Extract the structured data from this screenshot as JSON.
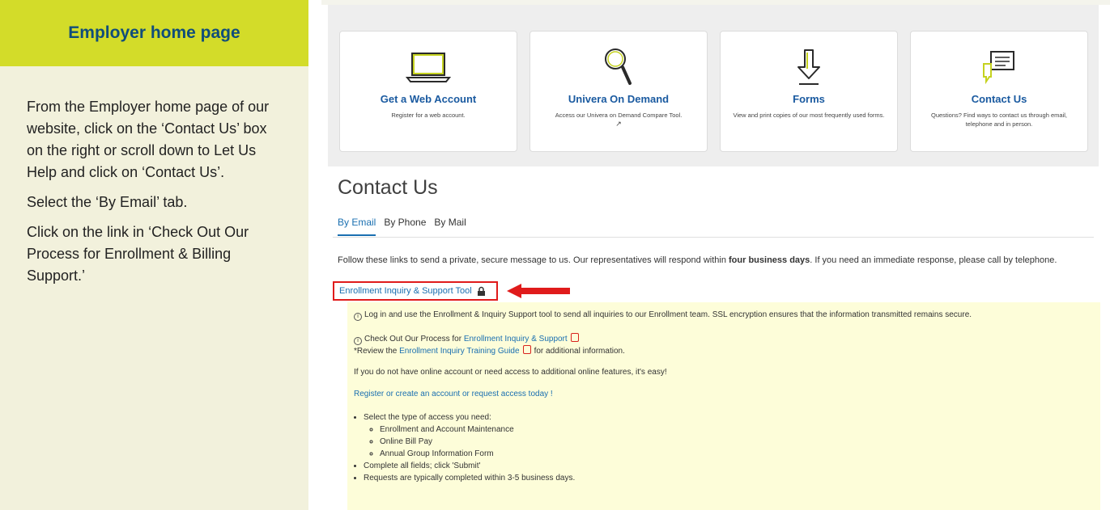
{
  "left": {
    "header": "Employer home page",
    "paragraphs": [
      "From the Employer home page of our website, click on the ‘Contact Us’ box on the right or scroll down to Let Us Help and click on ‘Contact Us’.",
      "Select the ‘By Email’ tab.",
      "Click on the link in ‘Check Out Our Process for Enrollment & Billing Support.’"
    ]
  },
  "cards": [
    {
      "title": "Get a Web Account",
      "desc": "Register for a web account.",
      "icon": "laptop-icon"
    },
    {
      "title": "Univera On Demand",
      "desc": "Access our Univera on Demand Compare Tool.",
      "icon": "magnifier-icon"
    },
    {
      "title": "Forms",
      "desc": "View and print copies of our most frequently used forms.",
      "icon": "download-arrow-icon"
    },
    {
      "title": "Contact Us",
      "desc": "Questions? Find ways to contact us through email, telephone and in person.",
      "icon": "chat-icon"
    }
  ],
  "contact": {
    "title": "Contact Us",
    "tabs": [
      "By Email",
      "By Phone",
      "By Mail"
    ],
    "intro_before": "Follow these links to send a private, secure message to us. Our representatives will respond within ",
    "intro_bold": "four business days",
    "intro_after": ". If you need an immediate response, please call by telephone.",
    "tool_link": "Enrollment Inquiry & Support Tool"
  },
  "box": {
    "line1": "Log in and use the Enrollment & Inquiry Support tool to send all inquiries to our Enrollment team. SSL encryption ensures that the information transmitted remains secure.",
    "line2_prefix": "Check Out Our Process for ",
    "line2_link": "Enrollment Inquiry & Support",
    "line3_prefix": "*Review the ",
    "line3_link": "Enrollment Inquiry Training Guide",
    "line3_suffix": "for additional information.",
    "line4": "If you do not have online account or need access to additional online features, it's easy!",
    "register_link": "Register or create an account or request access today !",
    "step1": "Select the type of access you need:",
    "substeps": [
      "Enrollment and Account Maintenance",
      "Online Bill Pay",
      "Annual Group Information Form"
    ],
    "step2": "Complete all fields; click 'Submit'",
    "step3": "Requests are typically completed within 3-5 business days."
  },
  "colors": {
    "header_green": "#d3dc29",
    "title_blue": "#104d7b",
    "link_blue": "#1a6fb0",
    "highlight_red": "#e01b1b"
  }
}
